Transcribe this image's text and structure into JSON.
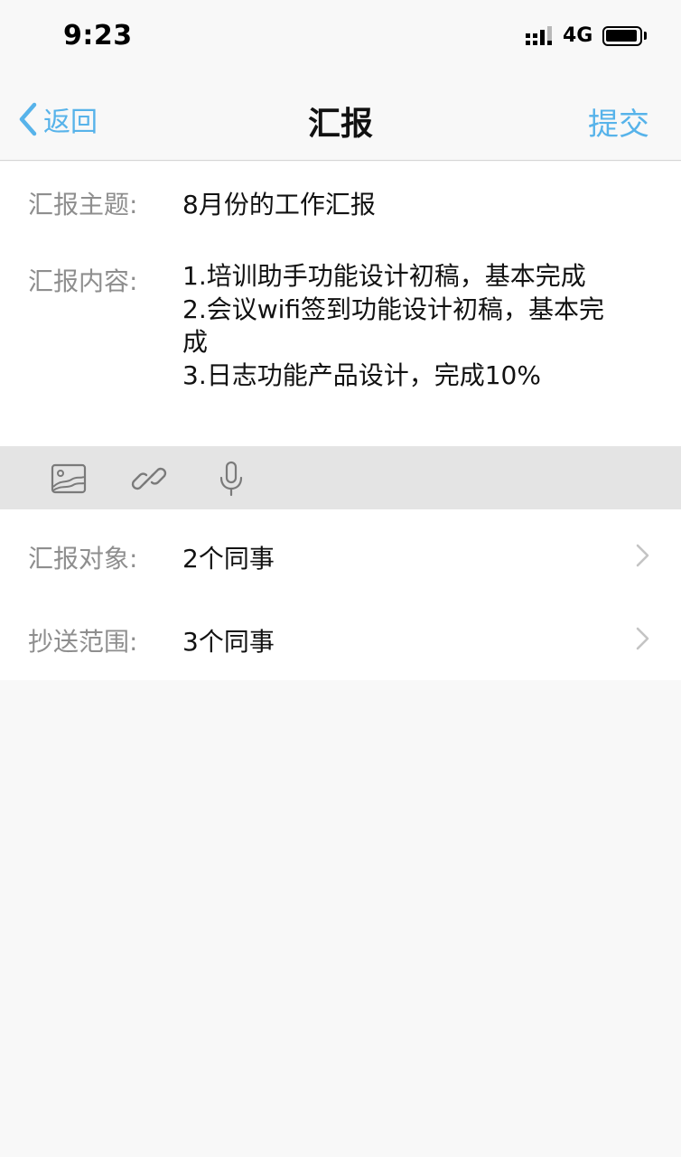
{
  "status_bar": {
    "time": "9:23",
    "network": "4G",
    "icons": [
      "signal-icon",
      "battery-icon"
    ]
  },
  "nav": {
    "back_label": "返回",
    "title": "汇报",
    "submit_label": "提交",
    "accent_color": "#57b3ea"
  },
  "form": {
    "subject_label": "汇报主题:",
    "subject_value": "8月份的工作汇报",
    "content_label": "汇报内容:",
    "content_lines": [
      "1.培训助手功能设计初稿，基本完成",
      "2.会议wifi签到功能设计初稿，基本完",
      "成",
      "3.日志功能产品设计，完成10%"
    ]
  },
  "toolbar": {
    "icons": [
      "image-icon",
      "link-icon",
      "microphone-icon"
    ]
  },
  "rows": [
    {
      "label": "汇报对象:",
      "value": "2个同事"
    },
    {
      "label": "抄送范围:",
      "value": "3个同事"
    }
  ]
}
